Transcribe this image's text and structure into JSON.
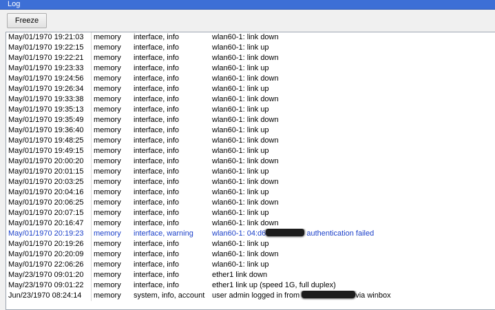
{
  "window": {
    "title": "Log"
  },
  "toolbar": {
    "freeze_label": "Freeze"
  },
  "colors": {
    "titlebar": "#3d6fd6",
    "warning_text": "#1a3fc9"
  },
  "log": {
    "rows": [
      {
        "time": "May/01/1970 19:21:03",
        "buffer": "memory",
        "topics": "interface, info",
        "message": "wlan60-1: link down"
      },
      {
        "time": "May/01/1970 19:22:15",
        "buffer": "memory",
        "topics": "interface, info",
        "message": "wlan60-1: link up"
      },
      {
        "time": "May/01/1970 19:22:21",
        "buffer": "memory",
        "topics": "interface, info",
        "message": "wlan60-1: link down"
      },
      {
        "time": "May/01/1970 19:23:33",
        "buffer": "memory",
        "topics": "interface, info",
        "message": "wlan60-1: link up"
      },
      {
        "time": "May/01/1970 19:24:56",
        "buffer": "memory",
        "topics": "interface, info",
        "message": "wlan60-1: link down"
      },
      {
        "time": "May/01/1970 19:26:34",
        "buffer": "memory",
        "topics": "interface, info",
        "message": "wlan60-1: link up"
      },
      {
        "time": "May/01/1970 19:33:38",
        "buffer": "memory",
        "topics": "interface, info",
        "message": "wlan60-1: link down"
      },
      {
        "time": "May/01/1970 19:35:13",
        "buffer": "memory",
        "topics": "interface, info",
        "message": "wlan60-1: link up"
      },
      {
        "time": "May/01/1970 19:35:49",
        "buffer": "memory",
        "topics": "interface, info",
        "message": "wlan60-1: link down"
      },
      {
        "time": "May/01/1970 19:36:40",
        "buffer": "memory",
        "topics": "interface, info",
        "message": "wlan60-1: link up"
      },
      {
        "time": "May/01/1970 19:48:25",
        "buffer": "memory",
        "topics": "interface, info",
        "message": "wlan60-1: link down"
      },
      {
        "time": "May/01/1970 19:49:15",
        "buffer": "memory",
        "topics": "interface, info",
        "message": "wlan60-1: link up"
      },
      {
        "time": "May/01/1970 20:00:20",
        "buffer": "memory",
        "topics": "interface, info",
        "message": "wlan60-1: link down"
      },
      {
        "time": "May/01/1970 20:01:15",
        "buffer": "memory",
        "topics": "interface, info",
        "message": "wlan60-1: link up"
      },
      {
        "time": "May/01/1970 20:03:25",
        "buffer": "memory",
        "topics": "interface, info",
        "message": "wlan60-1: link down"
      },
      {
        "time": "May/01/1970 20:04:16",
        "buffer": "memory",
        "topics": "interface, info",
        "message": "wlan60-1: link up"
      },
      {
        "time": "May/01/1970 20:06:25",
        "buffer": "memory",
        "topics": "interface, info",
        "message": "wlan60-1: link down"
      },
      {
        "time": "May/01/1970 20:07:15",
        "buffer": "memory",
        "topics": "interface, info",
        "message": "wlan60-1: link up"
      },
      {
        "time": "May/01/1970 20:16:47",
        "buffer": "memory",
        "topics": "interface, info",
        "message": "wlan60-1: link down"
      },
      {
        "time": "May/01/1970 20:19:23",
        "buffer": "memory",
        "topics": "interface, warning",
        "message_prefix": "wlan60-1: 04:d6",
        "message_suffix": " authentication failed",
        "warning": true
      },
      {
        "time": "May/01/1970 20:19:26",
        "buffer": "memory",
        "topics": "interface, info",
        "message": "wlan60-1: link up"
      },
      {
        "time": "May/01/1970 20:20:09",
        "buffer": "memory",
        "topics": "interface, info",
        "message": "wlan60-1: link down"
      },
      {
        "time": "May/01/1970 22:06:26",
        "buffer": "memory",
        "topics": "interface, info",
        "message": "wlan60-1: link up"
      },
      {
        "time": "May/23/1970 09:01:20",
        "buffer": "memory",
        "topics": "interface, info",
        "message": "ether1 link down"
      },
      {
        "time": "May/23/1970 09:01:22",
        "buffer": "memory",
        "topics": "interface, info",
        "message": "ether1 link up (speed 1G, full duplex)"
      },
      {
        "time": "Jun/23/1970 08:24:14",
        "buffer": "memory",
        "topics": "system, info, account",
        "message_prefix": "user admin logged in from ",
        "message_suffix": "via winbox"
      }
    ]
  }
}
